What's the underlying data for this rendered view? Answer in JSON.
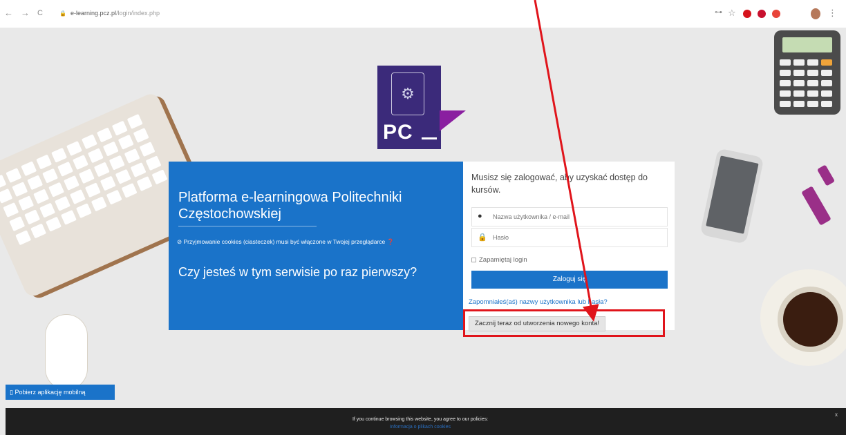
{
  "browser": {
    "nav_back": "←",
    "nav_forward": "→",
    "nav_reload": "C",
    "url_host": "e-learning.pcz.pl",
    "url_path": "/login/index.php",
    "key_icon": "⊶",
    "star_icon": "☆",
    "menu_icon": "⋮"
  },
  "logo": {
    "text": "PC"
  },
  "card": {
    "title": "Platforma e-learningowa Politechniki Częstochowskiej",
    "cookie_note": "Przyjmowanie cookies (ciasteczek) musi być włączone w Twojej przeglądarce",
    "first_time": "Czy jesteś w tym serwisie po raz pierwszy?",
    "prompt": "Musisz się zalogować, aby uzyskać dostęp do kursów.",
    "username_placeholder": "Nazwa użytkownika / e-mail",
    "password_placeholder": "Hasło",
    "remember_label": "Zapamiętaj login",
    "login_button": "Zaloguj się",
    "forgot_link": "Zapomniałeś(aś) nazwy użytkownika lub hasła?",
    "create_account_button": "Zacznij teraz od utworzenia nowego konta!"
  },
  "mobile_app_button": "Pobierz aplikację mobilną",
  "cookie_bar": {
    "text": "If you continue browsing this website, you agree to our policies:",
    "link": "Informacja o plikach cookies",
    "close": "x"
  },
  "colors": {
    "accent_blue": "#1a73c9",
    "highlight_red": "#e0141b"
  }
}
